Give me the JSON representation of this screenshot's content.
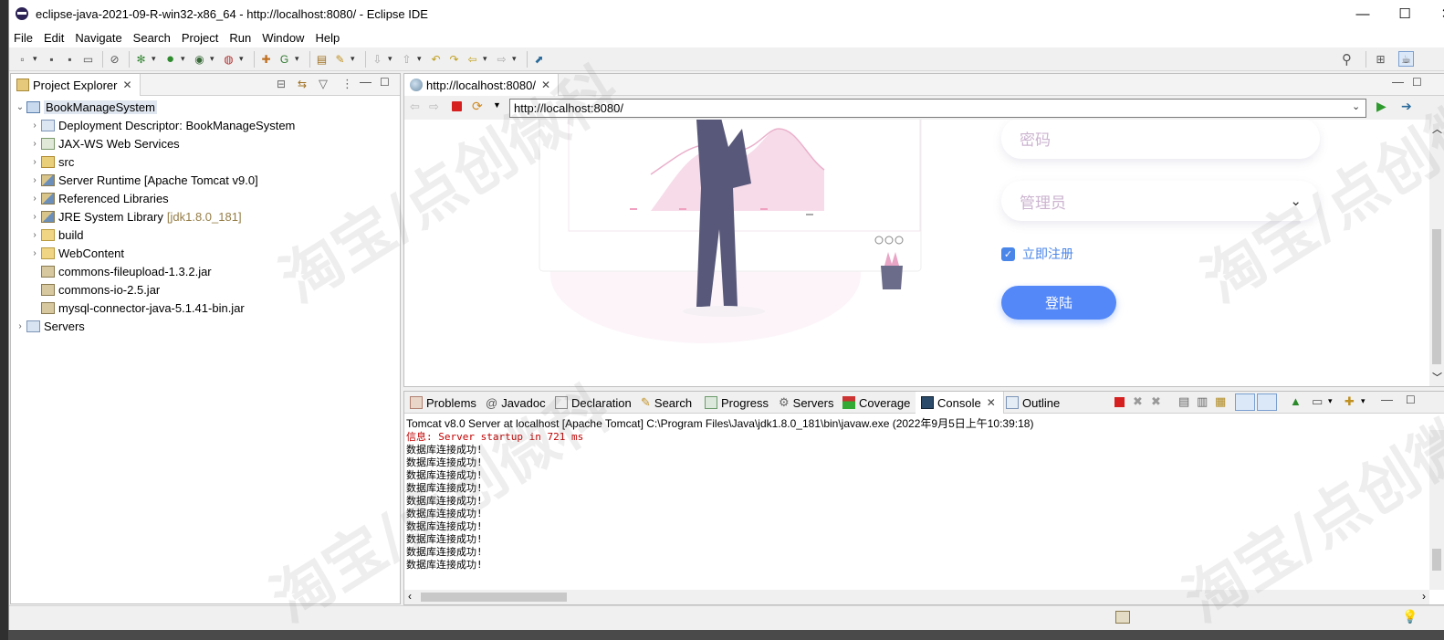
{
  "window": {
    "title": "eclipse-java-2021-09-R-win32-x86_64 - http://localhost:8080/ - Eclipse IDE",
    "minimize": "—",
    "maximize": "☐",
    "close": "✕"
  },
  "menu": [
    "File",
    "Edit",
    "Navigate",
    "Search",
    "Project",
    "Run",
    "Window",
    "Help"
  ],
  "explorer": {
    "tab": "Project Explorer",
    "root": "BookManageSystem",
    "items": [
      {
        "label": "Deployment Descriptor: BookManageSystem",
        "icon": "deployment-descriptor-icon"
      },
      {
        "label": "JAX-WS Web Services",
        "icon": "web-services-icon"
      },
      {
        "label": "src",
        "icon": "source-folder-icon"
      },
      {
        "label": "Server Runtime [Apache Tomcat v9.0]",
        "icon": "library-icon"
      },
      {
        "label": "Referenced Libraries",
        "icon": "library-icon"
      },
      {
        "label": "JRE System Library",
        "suffix": "[jdk1.8.0_181]",
        "icon": "library-icon"
      },
      {
        "label": "build",
        "icon": "folder-icon"
      },
      {
        "label": "WebContent",
        "icon": "folder-icon"
      },
      {
        "label": "commons-fileupload-1.3.2.jar",
        "icon": "jar-icon"
      },
      {
        "label": "commons-io-2.5.jar",
        "icon": "jar-icon"
      },
      {
        "label": "mysql-connector-java-5.1.41-bin.jar",
        "icon": "jar-icon"
      }
    ],
    "servers": "Servers"
  },
  "browser": {
    "tab": "http://localhost:8080/",
    "url": "http://localhost:8080/",
    "page": {
      "password_placeholder": "密码",
      "role_select": "管理员",
      "register_checkbox": "立即注册",
      "register_checked": true,
      "login_button": "登陆"
    }
  },
  "bottom_tabs": [
    "Problems",
    "Javadoc",
    "Declaration",
    "Search",
    "Progress",
    "Servers",
    "Coverage",
    "Console",
    "Outline"
  ],
  "console": {
    "header": "Tomcat v8.0 Server at localhost [Apache Tomcat] C:\\Program Files\\Java\\jdk1.8.0_181\\bin\\javaw.exe  (2022年9月5日上午10:39:18)",
    "startup_line": "信息: Server startup in 721 ms",
    "lines": [
      "数据库连接成功!",
      "数据库连接成功!",
      "数据库连接成功!",
      "数据库连接成功!",
      "数据库连接成功!",
      "数据库连接成功!",
      "数据库连接成功!",
      "数据库连接成功!",
      "数据库连接成功!",
      "数据库连接成功!"
    ]
  },
  "watermark": "淘宝/点创微科",
  "colors": {
    "accent_blue": "#5488f8",
    "console_red": "#c00000",
    "lib_suffix": "#957d47"
  }
}
